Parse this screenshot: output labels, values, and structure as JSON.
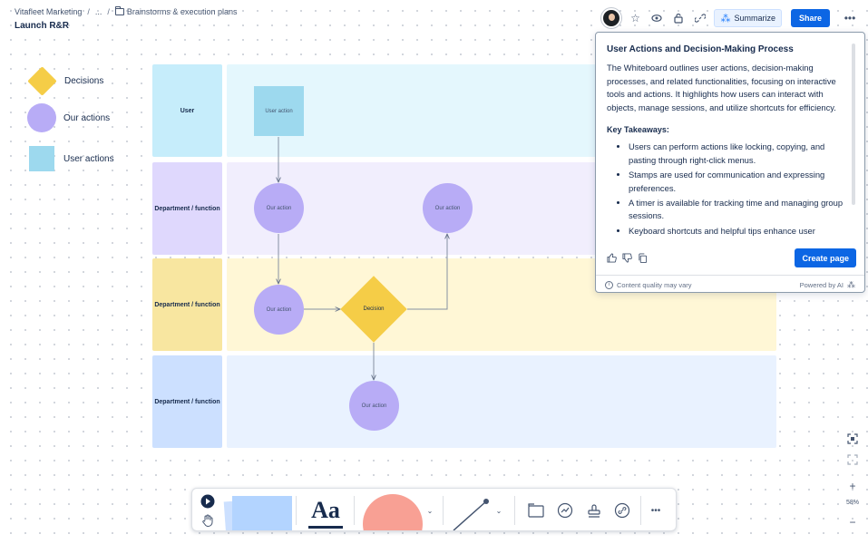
{
  "header": {
    "breadcrumb": [
      "Vitafleet Marketing",
      "...",
      "Brainstorms & execution plans"
    ],
    "breadcrumb_sep": "/",
    "page_title": "Launch R&R",
    "summarize_label": "Summarize",
    "share_label": "Share"
  },
  "legend": [
    {
      "shape": "diamond",
      "label": "Decisions"
    },
    {
      "shape": "circle",
      "label": "Our actions"
    },
    {
      "shape": "square",
      "label": "User actions"
    }
  ],
  "lanes": [
    {
      "label": "User"
    },
    {
      "label": "Department / function"
    },
    {
      "label": "Department / function"
    },
    {
      "label": "Department / function"
    }
  ],
  "nodes": {
    "user_action": "User action",
    "our_action_1": "Our action",
    "our_action_2": "Our action",
    "our_action_3": "Our action",
    "our_action_4": "Our action",
    "decision": "Decision"
  },
  "ai_panel": {
    "title": "User Actions and Decision-Making Process",
    "summary": "The Whiteboard outlines user actions, decision-making processes, and related functionalities, focusing on interactive tools and actions. It highlights how users can interact with objects, manage sessions, and utilize shortcuts for efficiency.",
    "key_takeaways_label": "Key Takeaways:",
    "takeaways": [
      "Users can perform actions like locking, copying, and pasting through right-click menus.",
      "Stamps are used for communication and expressing preferences.",
      "A timer is available for tracking time and managing group sessions.",
      "Keyboard shortcuts and helpful tips enhance user"
    ],
    "create_page_label": "Create page",
    "quality_note": "Content quality may vary",
    "powered_by": "Powered by AI"
  },
  "zoom": {
    "level": "58%",
    "plus": "+",
    "minus": "−"
  },
  "toolbar": {
    "text_tool_label": "Aa",
    "more": "•••"
  },
  "colors": {
    "user_lane": "#c6edfb",
    "dept_lane_purple": "#dfd8fd",
    "dept_lane_yellow": "#f8e6a0",
    "dept_lane_blue": "#cce0ff",
    "accent": "#0c66e4"
  }
}
